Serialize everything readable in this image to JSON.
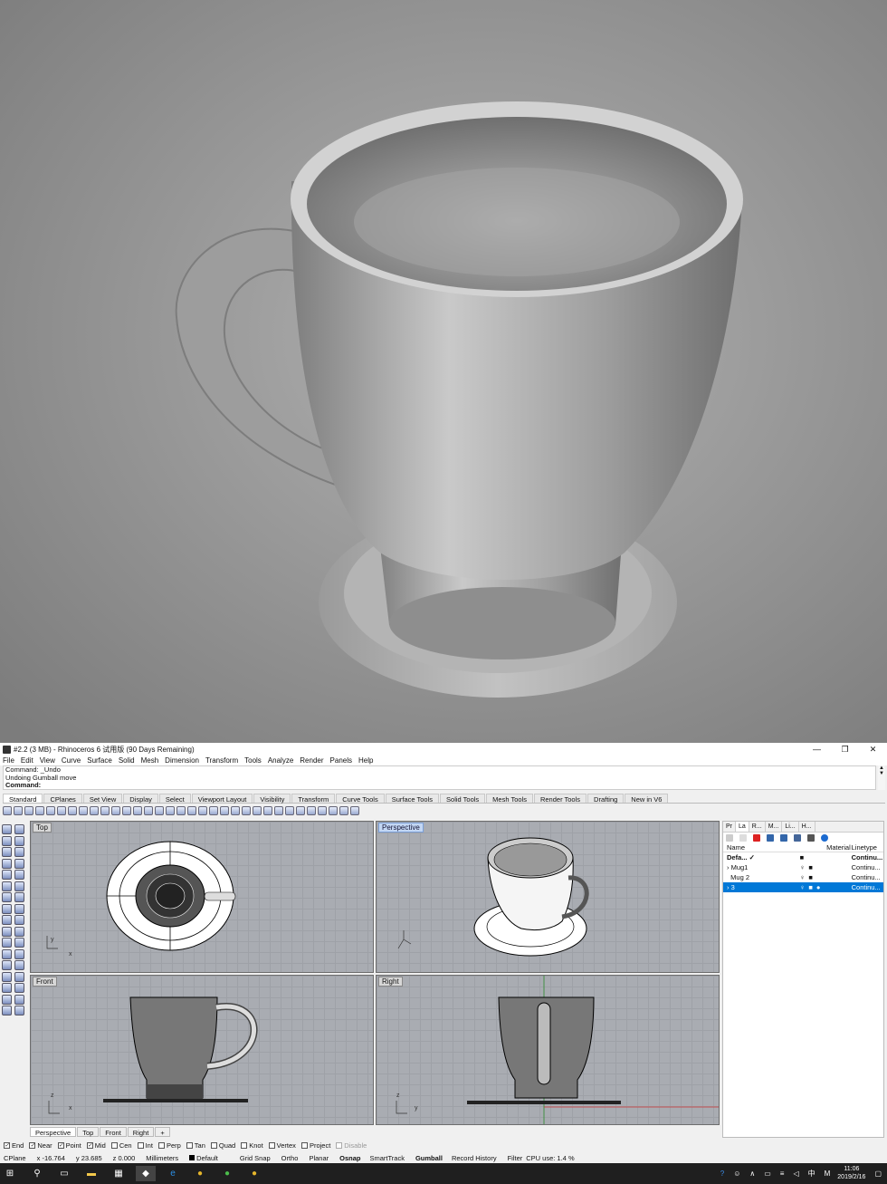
{
  "window": {
    "title": "#2.2 (3 MB) - Rhinoceros 6 试用版 (90 Days Remaining)",
    "minimize": "—",
    "maximize": "❐",
    "close": "✕"
  },
  "menu": [
    "File",
    "Edit",
    "View",
    "Curve",
    "Surface",
    "Solid",
    "Mesh",
    "Dimension",
    "Transform",
    "Tools",
    "Analyze",
    "Render",
    "Panels",
    "Help"
  ],
  "command_history": [
    "Command: _Undo",
    "Undoing Gumball move"
  ],
  "command_prompt": "Command:",
  "toolbar_tabs": [
    "Standard",
    "CPlanes",
    "Set View",
    "Display",
    "Select",
    "Viewport Layout",
    "Visibility",
    "Transform",
    "Curve Tools",
    "Surface Tools",
    "Solid Tools",
    "Mesh Tools",
    "Render Tools",
    "Drafting",
    "New in V6"
  ],
  "viewports": {
    "top": "Top",
    "perspective": "Perspective",
    "front": "Front",
    "right": "Right"
  },
  "axis_labels": {
    "x": "x",
    "y": "y",
    "z": "z"
  },
  "panel": {
    "tabs": [
      "Pr",
      "La",
      "R...",
      "M...",
      "Li...",
      "H..."
    ],
    "headers": {
      "name": "Name",
      "material": "Material",
      "linetype": "Linetype"
    },
    "layers": [
      {
        "name": "Defa...",
        "check": "✓",
        "linetype": "Continu...",
        "selected": false
      },
      {
        "name": "Mug1",
        "check": "",
        "linetype": "Continu...",
        "selected": false
      },
      {
        "name": "Mug 2",
        "check": "",
        "linetype": "Continu...",
        "selected": false
      },
      {
        "name": "3",
        "check": "",
        "linetype": "Continu...",
        "selected": true
      }
    ]
  },
  "viewport_tabs": [
    "Perspective",
    "Top",
    "Front",
    "Right",
    "+"
  ],
  "osnaps": [
    {
      "label": "End",
      "checked": true
    },
    {
      "label": "Near",
      "checked": true
    },
    {
      "label": "Point",
      "checked": true
    },
    {
      "label": "Mid",
      "checked": true
    },
    {
      "label": "Cen",
      "checked": false
    },
    {
      "label": "Int",
      "checked": false
    },
    {
      "label": "Perp",
      "checked": false
    },
    {
      "label": "Tan",
      "checked": false
    },
    {
      "label": "Quad",
      "checked": false
    },
    {
      "label": "Knot",
      "checked": false
    },
    {
      "label": "Vertex",
      "checked": false
    },
    {
      "label": "Project",
      "checked": false
    },
    {
      "label": "Disable",
      "checked": false
    }
  ],
  "status": {
    "cplane": "CPlane",
    "x": "x -16.764",
    "y": "y 23.685",
    "z": "z 0.000",
    "units": "Millimeters",
    "layer": "Default",
    "toggles": [
      "Grid Snap",
      "Ortho",
      "Planar",
      "Osnap",
      "SmartTrack",
      "Gumball",
      "Record History",
      "Filter"
    ],
    "cpu": "CPU use: 1.4 %"
  },
  "taskbar": {
    "ime": "中",
    "ime2": "M",
    "time": "11:06",
    "date": "2019/2/16"
  },
  "colors": {
    "selected_row": "#0078d7",
    "viewport_bg": "#a9acb2"
  }
}
